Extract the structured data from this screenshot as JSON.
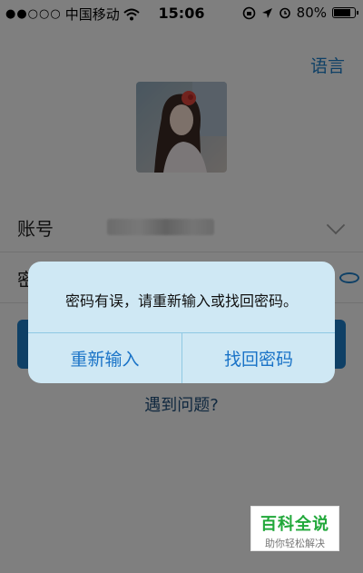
{
  "status_bar": {
    "signal_dots": "●●○○○",
    "carrier": "中国移动",
    "time": "15:06",
    "battery_percent_label": "80%",
    "battery_level": 0.8,
    "icons": [
      "wifi-icon",
      "rotation-lock-icon",
      "location-arrow-icon",
      "alarm-icon",
      "battery-icon"
    ]
  },
  "header": {
    "language_link": "语言"
  },
  "form": {
    "account_label": "账号",
    "password_label": "密码"
  },
  "login_button": {
    "color": "#1d7cc3"
  },
  "help_link": "遇到问题?",
  "alert": {
    "message": "密码有误，请重新输入或找回密码。",
    "buttons": [
      "重新输入",
      "找回密码"
    ]
  },
  "watermark": {
    "title": "百科全说",
    "subtitle": "助你轻松解决"
  },
  "colors": {
    "accent": "#1d7cc3",
    "alert_bg": "#cfe8f4",
    "watermark_green": "#21a83a"
  }
}
